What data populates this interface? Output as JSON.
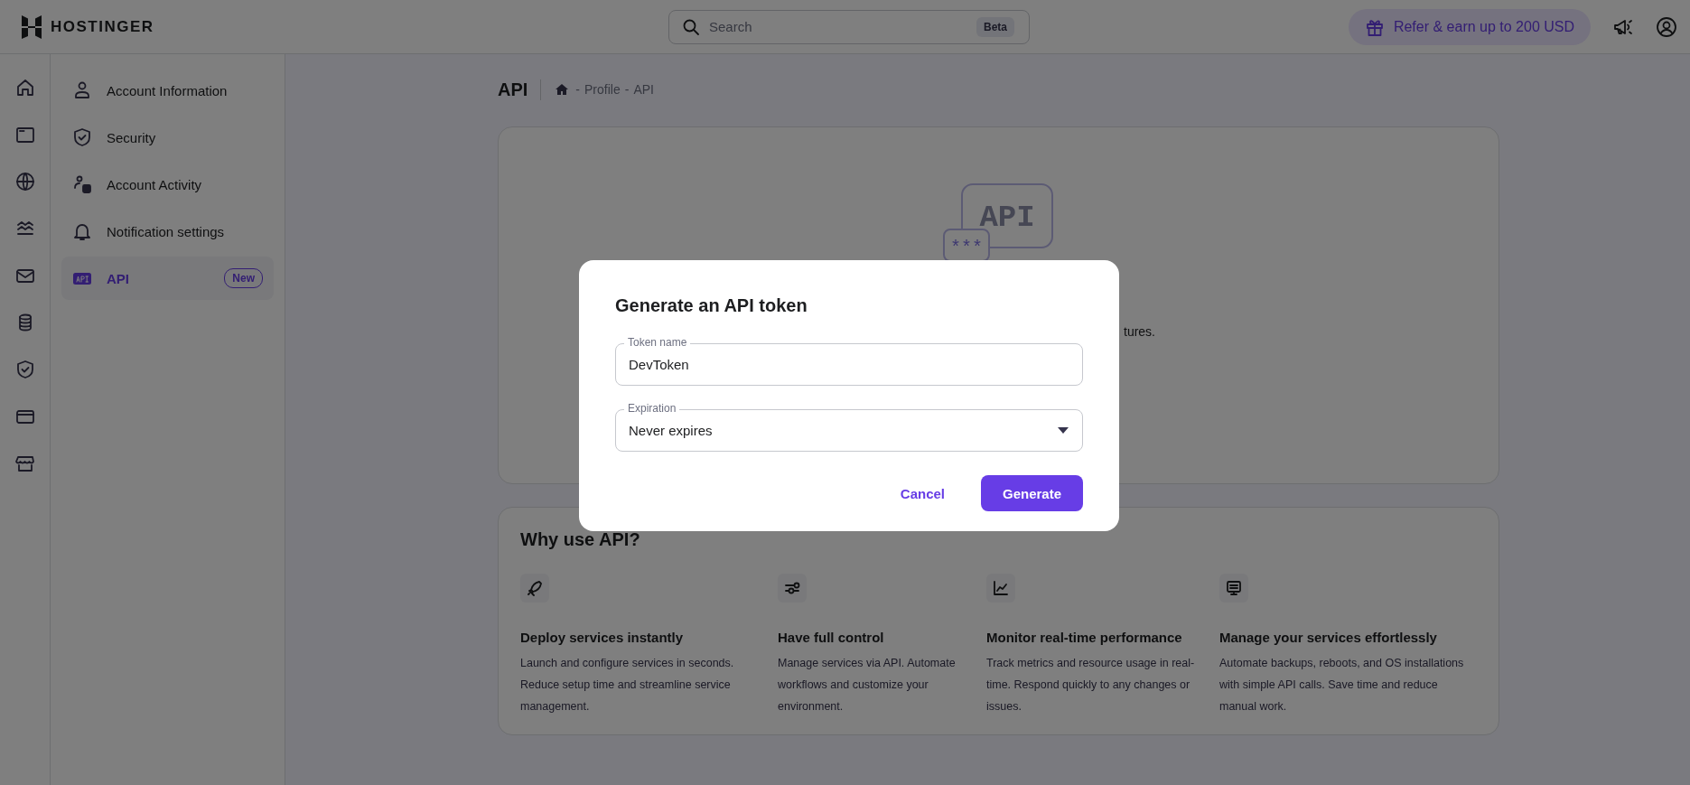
{
  "header": {
    "logo": "HOSTINGER",
    "search": {
      "placeholder": "Search",
      "badge": "Beta"
    },
    "refer_button": "Refer & earn up to 200 USD"
  },
  "settings_menu": {
    "items": [
      {
        "label": "Account Information",
        "selected": false
      },
      {
        "label": "Security",
        "selected": false
      },
      {
        "label": "Account Activity",
        "selected": false
      },
      {
        "label": "Notification settings",
        "selected": false
      },
      {
        "label": "API",
        "selected": true,
        "badge": "New"
      }
    ]
  },
  "page": {
    "title": "API",
    "breadcrumb": {
      "separator": "-",
      "items": [
        "Profile",
        "API"
      ]
    }
  },
  "intro_card": {
    "illustration": {
      "label": "API",
      "mask": "***"
    },
    "text_fragment": "tures."
  },
  "why_card": {
    "title": "Why use API?",
    "features": [
      {
        "title": "Deploy services instantly",
        "text": "Launch and configure services in seconds. Reduce setup time and streamline service management."
      },
      {
        "title": "Have full control",
        "text": "Manage services via API. Automate workflows and customize your environment."
      },
      {
        "title": "Monitor real-time performance",
        "text": "Track metrics and resource usage in real-time. Respond quickly to any changes or issues."
      },
      {
        "title": "Manage your services effortlessly",
        "text": "Automate backups, reboots, and OS installations with simple API calls. Save time and reduce manual work."
      }
    ]
  },
  "modal": {
    "title": "Generate an API token",
    "fields": [
      {
        "kind": "text",
        "label": "Token name",
        "value": "DevToken"
      },
      {
        "kind": "select",
        "label": "Expiration",
        "value": "Never expires"
      }
    ],
    "buttons": [
      {
        "kind": "secondary",
        "label": "Cancel"
      },
      {
        "kind": "primary",
        "label": "Generate"
      }
    ]
  }
}
